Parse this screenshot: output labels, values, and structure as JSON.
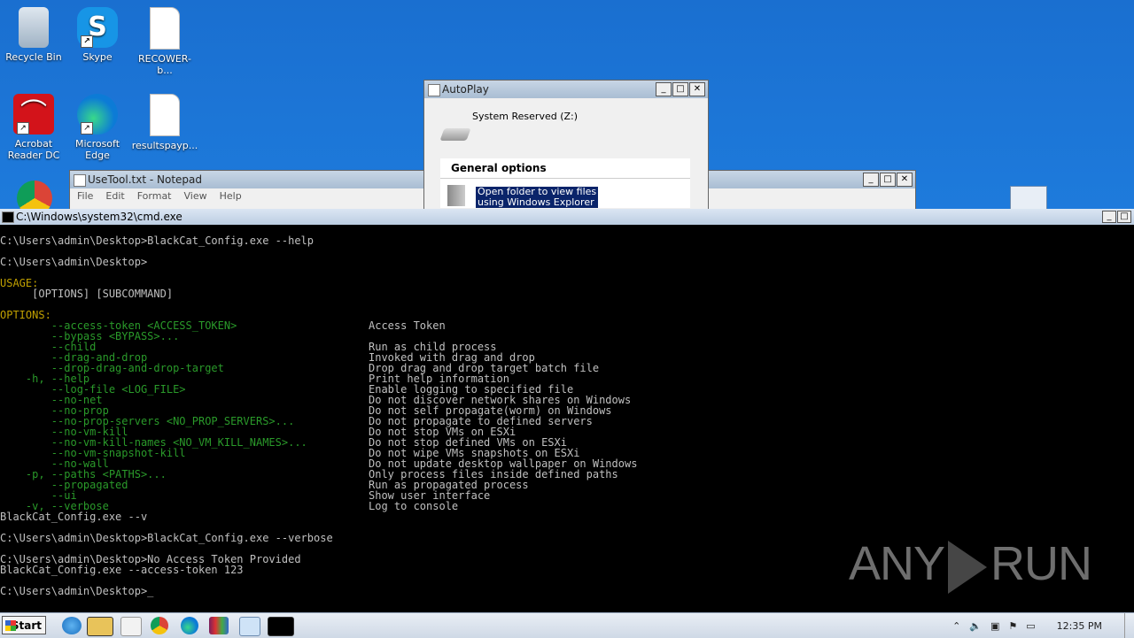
{
  "desktop": {
    "icons": [
      {
        "label": "Recycle Bin"
      },
      {
        "label": "Skype",
        "glyph": "S"
      },
      {
        "label": "RECOWER-b..."
      },
      {
        "label": "Acrobat Reader DC"
      },
      {
        "label": "Microsoft Edge"
      },
      {
        "label": "resultspayp..."
      }
    ]
  },
  "autoplay": {
    "title": "AutoPlay",
    "drive": "System Reserved (Z:)",
    "general_options": "General options",
    "option1": "Open folder to view files",
    "option1_sub": "using Windows Explorer"
  },
  "notepad": {
    "title": "UseTool.txt - Notepad",
    "menu": [
      "File",
      "Edit",
      "Format",
      "View",
      "Help"
    ]
  },
  "cmd": {
    "title": "C:\\Windows\\system32\\cmd.exe",
    "lines": [
      {
        "t": "C:\\Users\\admin\\Desktop>BlackCat_Config.exe --help"
      },
      {
        "t": ""
      },
      {
        "t": "C:\\Users\\admin\\Desktop>"
      },
      {
        "t": ""
      },
      {
        "t": "USAGE:",
        "c": "yel"
      },
      {
        "t": "     [OPTIONS] [SUBCOMMAND]"
      },
      {
        "t": ""
      },
      {
        "t": "OPTIONS:",
        "c": "yel"
      },
      {
        "t": "        --access-token <ACCESS_TOKEN>",
        "c": "grn",
        "d": "Access Token"
      },
      {
        "t": "        --bypass <BYPASS>...",
        "c": "grn"
      },
      {
        "t": "        --child",
        "c": "grn",
        "d": "Run as child process"
      },
      {
        "t": "        --drag-and-drop",
        "c": "grn",
        "d": "Invoked with drag and drop"
      },
      {
        "t": "        --drop-drag-and-drop-target",
        "c": "grn",
        "d": "Drop drag and drop target batch file"
      },
      {
        "t": "    -h, --help",
        "c": "grn",
        "d": "Print help information"
      },
      {
        "t": "        --log-file <LOG_FILE>",
        "c": "grn",
        "d": "Enable logging to specified file"
      },
      {
        "t": "        --no-net",
        "c": "grn",
        "d": "Do not discover network shares on Windows"
      },
      {
        "t": "        --no-prop",
        "c": "grn",
        "d": "Do not self propagate(worm) on Windows"
      },
      {
        "t": "        --no-prop-servers <NO_PROP_SERVERS>...",
        "c": "grn",
        "d": "Do not propagate to defined servers"
      },
      {
        "t": "        --no-vm-kill",
        "c": "grn",
        "d": "Do not stop VMs on ESXi"
      },
      {
        "t": "        --no-vm-kill-names <NO_VM_KILL_NAMES>...",
        "c": "grn",
        "d": "Do not stop defined VMs on ESXi"
      },
      {
        "t": "        --no-vm-snapshot-kill",
        "c": "grn",
        "d": "Do not wipe VMs snapshots on ESXi"
      },
      {
        "t": "        --no-wall",
        "c": "grn",
        "d": "Do not update desktop wallpaper on Windows"
      },
      {
        "t": "    -p, --paths <PATHS>...",
        "c": "grn",
        "d": "Only process files inside defined paths"
      },
      {
        "t": "        --propagated",
        "c": "grn",
        "d": "Run as propagated process"
      },
      {
        "t": "        --ui",
        "c": "grn",
        "d": "Show user interface"
      },
      {
        "t": "    -v, --verbose",
        "c": "grn",
        "d": "Log to console"
      },
      {
        "t": "BlackCat_Config.exe --v"
      },
      {
        "t": ""
      },
      {
        "t": "C:\\Users\\admin\\Desktop>BlackCat_Config.exe --verbose"
      },
      {
        "t": ""
      },
      {
        "t": "C:\\Users\\admin\\Desktop>No Access Token Provided"
      },
      {
        "t": "BlackCat_Config.exe --access-token 123"
      },
      {
        "t": ""
      },
      {
        "t": "C:\\Users\\admin\\Desktop>_"
      }
    ]
  },
  "watermark": {
    "left": "ANY",
    "right": "RUN"
  },
  "taskbar": {
    "start": "Start",
    "clock": "12:35 PM"
  }
}
